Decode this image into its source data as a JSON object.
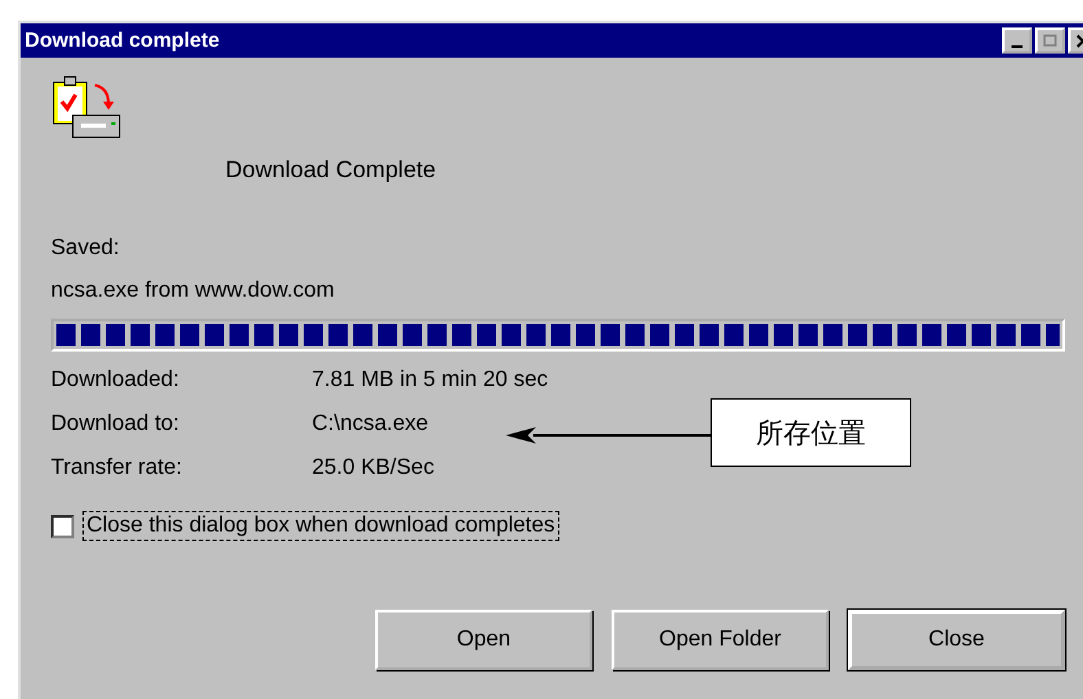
{
  "window": {
    "title": "Download complete"
  },
  "heading": "Download Complete",
  "saved_label": "Saved:",
  "saved_file": "ncsa.exe from www.dow.com",
  "progress": {
    "level": 1
  },
  "details": [
    {
      "label": "Downloaded:",
      "value": "7.81 MB in 5 min 20 sec"
    },
    {
      "label": "Download to:",
      "value": "C:\\ncsa.exe"
    },
    {
      "label": "Transfer rate:",
      "value": "25.0 KB/Sec"
    }
  ],
  "close_when_done": {
    "label": "Close this dialog box when download completes",
    "checked": false
  },
  "buttons": [
    {
      "label": "Open",
      "default": false
    },
    {
      "label": "Open Folder",
      "default": false
    },
    {
      "label": "Close",
      "default": true
    }
  ],
  "annotation": {
    "text": "所存位置"
  }
}
